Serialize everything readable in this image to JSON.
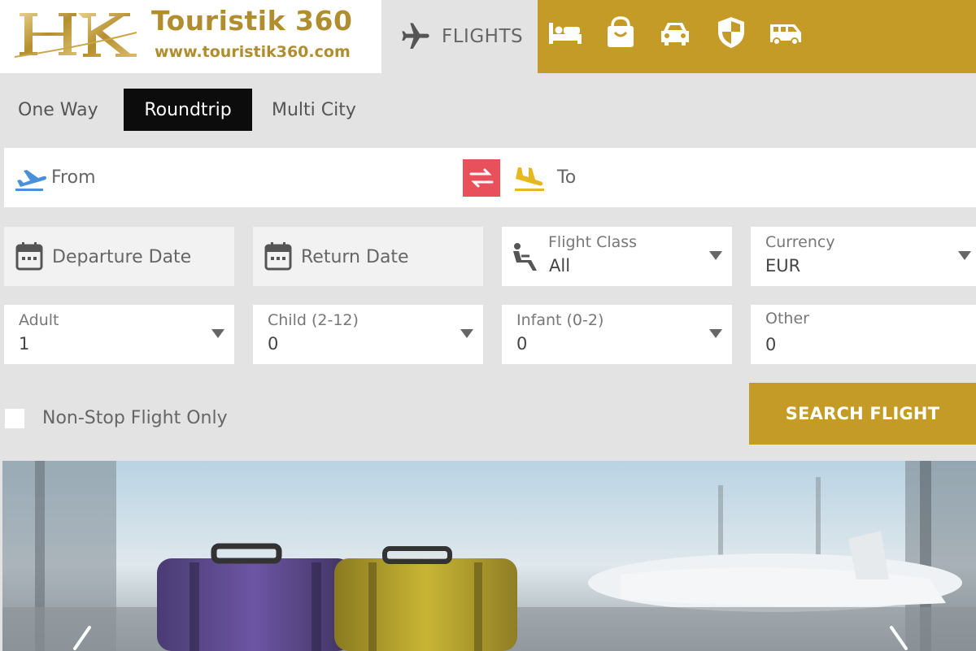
{
  "brand": {
    "name": "Touristik 360",
    "url": "www.touristik360.com",
    "logo_letters": "HK",
    "gold": "#c49b26"
  },
  "tabs": {
    "flights_label": "FLIGHTS",
    "icons": [
      "flights-icon",
      "hotel-bed-icon",
      "shopping-bag-icon",
      "car-icon",
      "shield-icon",
      "van-icon"
    ]
  },
  "trip_types": {
    "one_way": "One Way",
    "roundtrip": "Roundtrip",
    "multi_city": "Multi City",
    "selected": "Roundtrip"
  },
  "route": {
    "from_placeholder": "From",
    "to_placeholder": "To",
    "swap_color": "#e8505b"
  },
  "dates": {
    "departure": "Departure Date",
    "return": "Return Date"
  },
  "flight_class": {
    "label": "Flight Class",
    "value": "All"
  },
  "currency": {
    "label": "Currency",
    "value": "EUR"
  },
  "passengers": {
    "adult": {
      "label": "Adult",
      "value": "1"
    },
    "child": {
      "label": "Child (2-12)",
      "value": "0"
    },
    "infant": {
      "label": "Infant (0-2)",
      "value": "0"
    },
    "other": {
      "label": "Other",
      "value": "0"
    }
  },
  "options": {
    "non_stop_label": "Non-Stop Flight Only",
    "non_stop_checked": false
  },
  "search_button": "SEARCH FLIGHT"
}
